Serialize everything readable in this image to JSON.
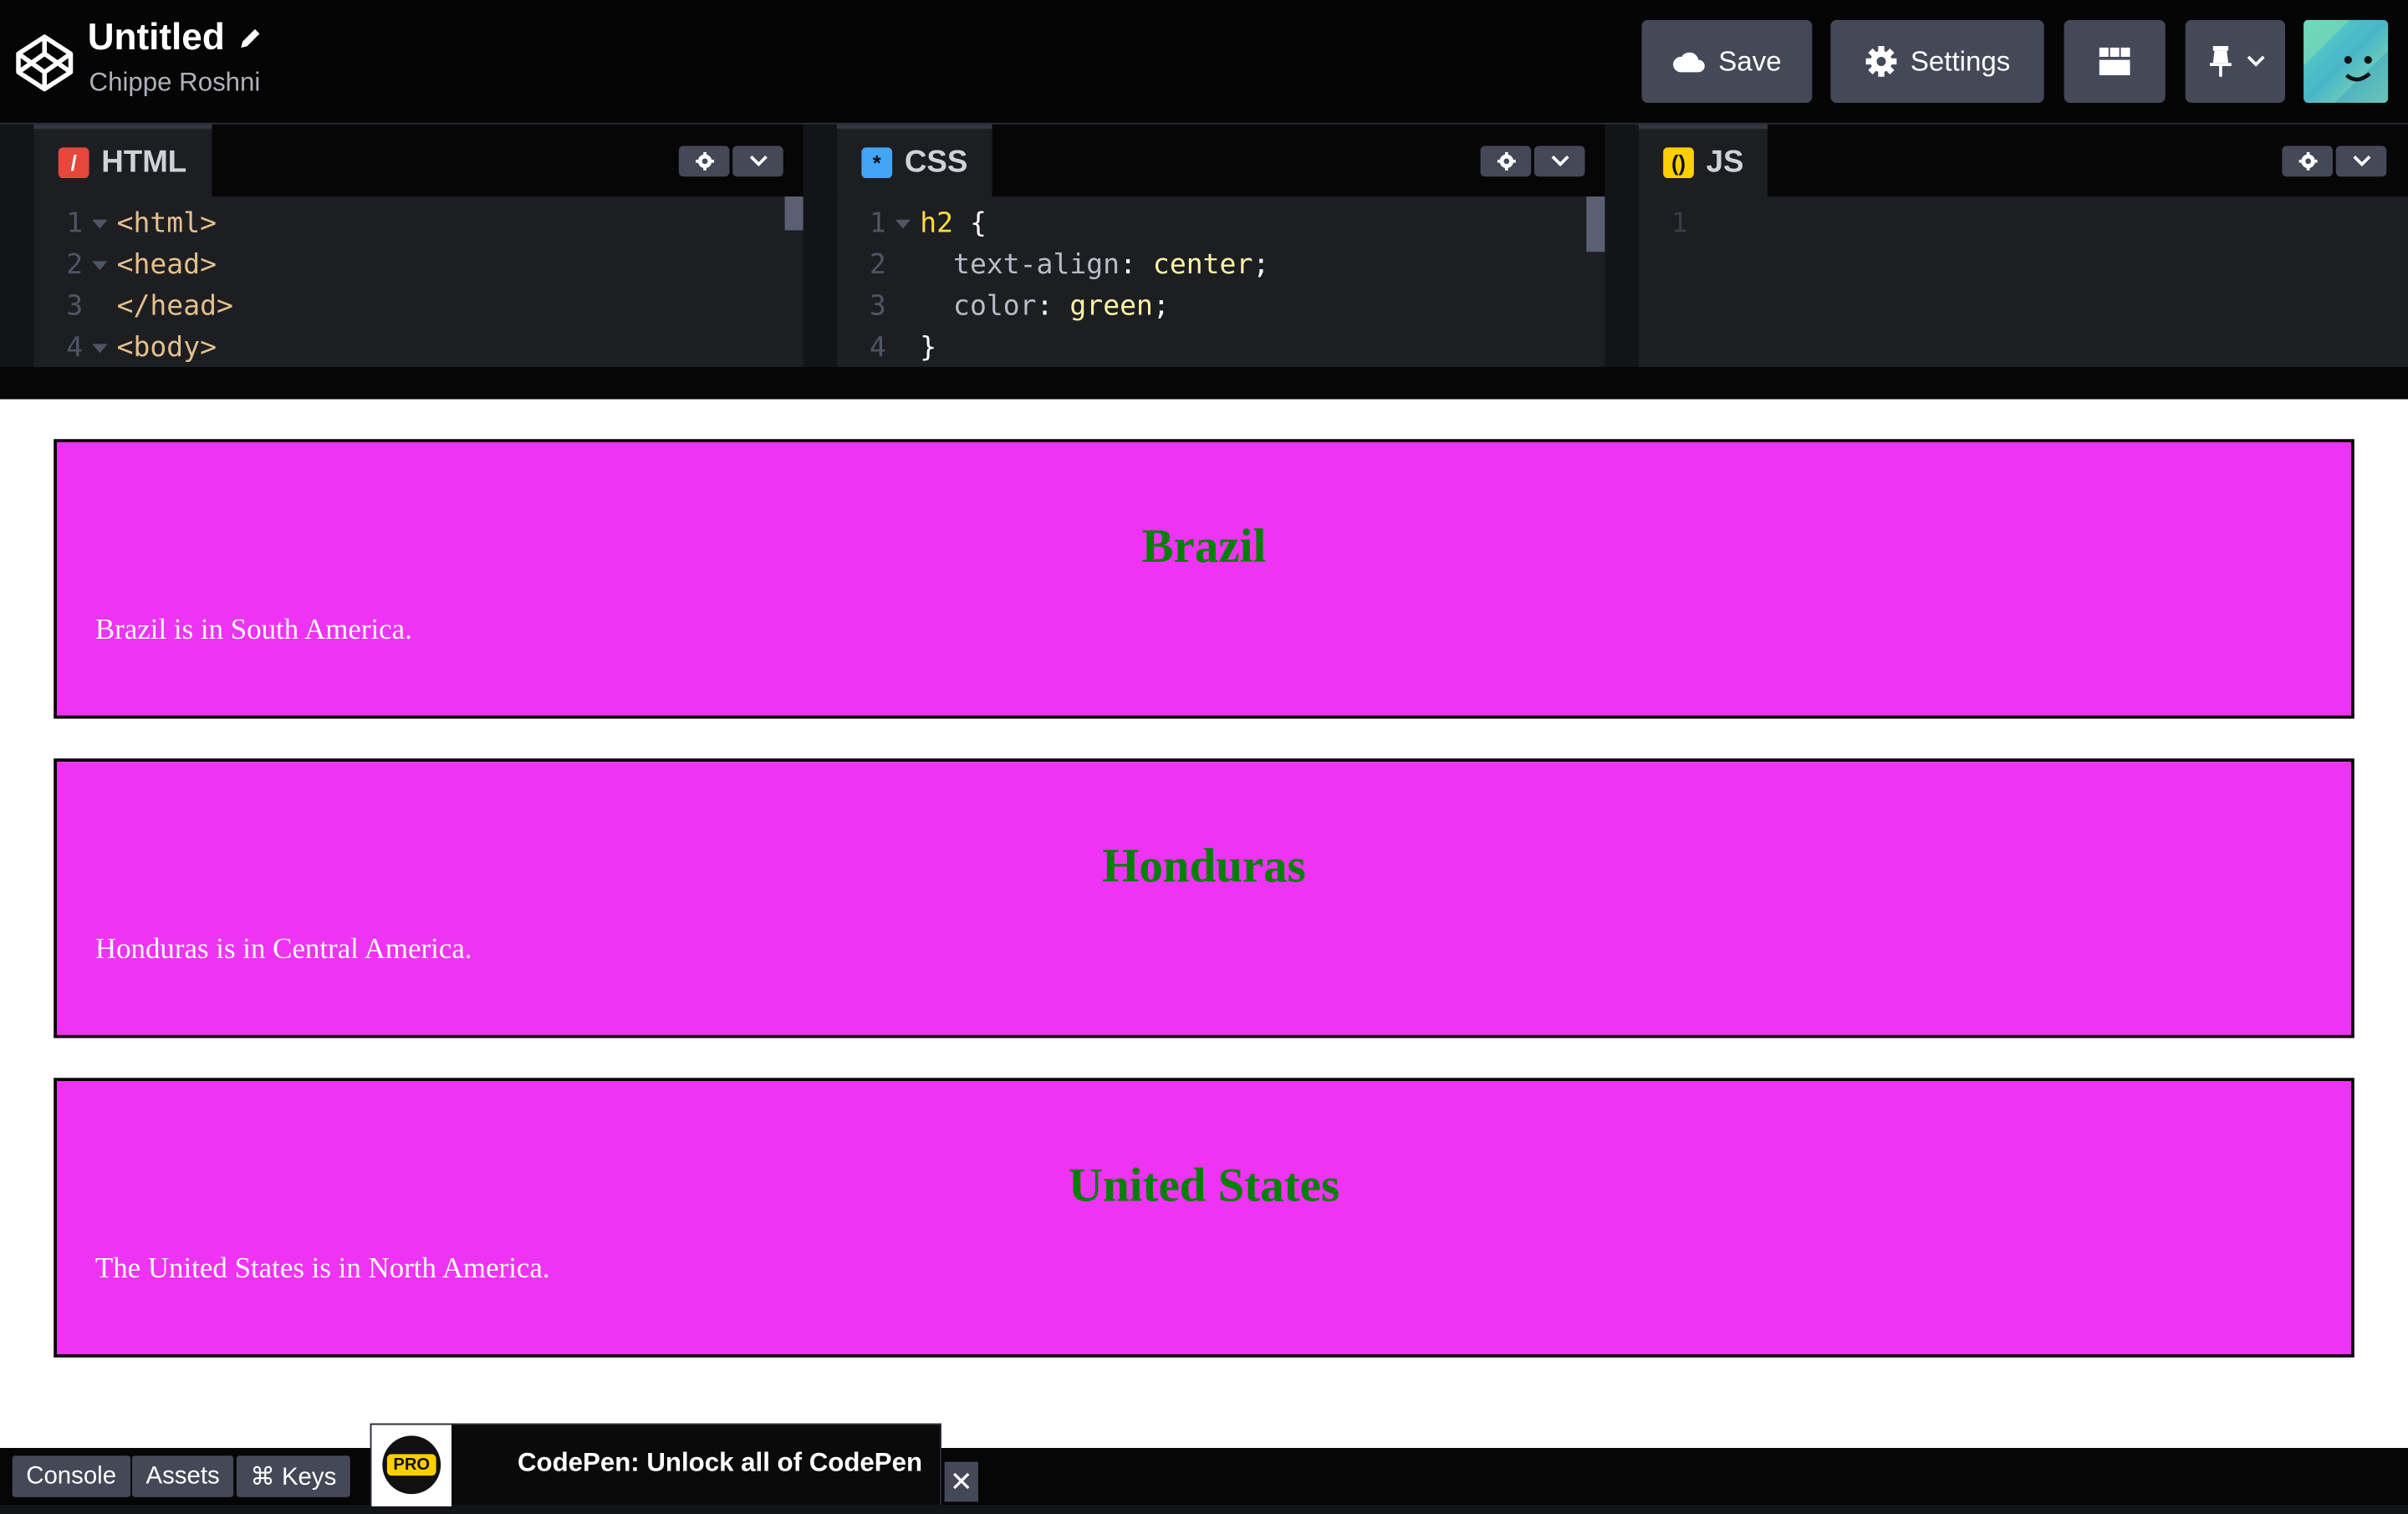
{
  "header": {
    "title": "Untitled",
    "author": "Chippe Roshni",
    "save_label": "Save",
    "settings_label": "Settings"
  },
  "editors": {
    "html": {
      "label": "HTML",
      "lines": [
        {
          "num": "1",
          "text": "<html>"
        },
        {
          "num": "2",
          "text": "<head>"
        },
        {
          "num": "3",
          "text": "</head>"
        },
        {
          "num": "4",
          "text": "<body>"
        }
      ]
    },
    "css": {
      "label": "CSS",
      "lines": [
        {
          "num": "1"
        },
        {
          "num": "2"
        },
        {
          "num": "3"
        },
        {
          "num": "4",
          "text": "}"
        }
      ],
      "tokens": {
        "selector": "h2",
        "brace_open": "{",
        "prop1": "text-align",
        "val1": "center",
        "prop2": "color",
        "val2": "green"
      }
    },
    "js": {
      "label": "JS",
      "lines": [
        {
          "num": "1",
          "text": ""
        }
      ]
    }
  },
  "preview": {
    "cards": [
      {
        "heading": "Brazil",
        "text": "Brazil is in South America."
      },
      {
        "heading": "Honduras",
        "text": "Honduras is in Central America."
      },
      {
        "heading": "United States",
        "text": "The United States is in North America."
      }
    ]
  },
  "footer": {
    "console_label": "Console",
    "assets_label": "Assets",
    "keys_label": "⌘ Keys",
    "promo_badge": "PRO",
    "promo_text": "CodePen: Unlock all of CodePen",
    "close_glyph": "✕"
  },
  "colors": {
    "card_bg": "#ef33f4",
    "heading": "green",
    "html_icon": "#e5473c",
    "css_icon": "#42a5f5",
    "js_icon": "#fcd000"
  },
  "icons": [
    "codepen-logo-icon",
    "pencil-icon",
    "cloud-icon",
    "gear-icon",
    "layout-icon",
    "pin-icon",
    "chevron-down-icon",
    "close-icon"
  ]
}
